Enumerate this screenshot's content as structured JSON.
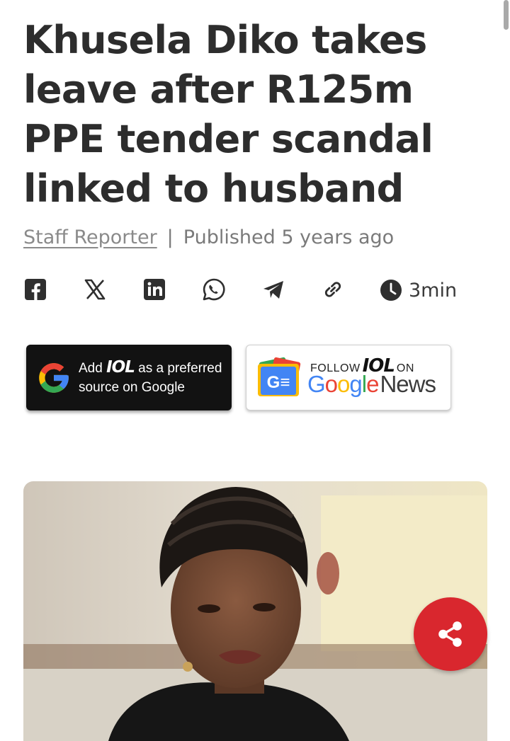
{
  "article": {
    "headline": "Khusela Diko takes leave after R125m PPE tender scandal linked to husband",
    "author": "Staff Reporter",
    "separator": "|",
    "published": "Published 5 years ago",
    "read_time": "3min"
  },
  "share_icons": [
    "facebook-icon",
    "x-icon",
    "linkedin-icon",
    "whatsapp-icon",
    "telegram-icon",
    "copy-link-icon"
  ],
  "google_preferred": {
    "line1_prefix": "Add",
    "brand": "IOL",
    "line1_suffix": "as a preferred",
    "line2": "source on Google"
  },
  "google_news": {
    "follow": "FOLLOW",
    "brand": "IOL",
    "on": "ON",
    "google_letters": [
      "G",
      "o",
      "o",
      "g",
      "l",
      "e"
    ],
    "news": "News",
    "badge": "G≡"
  },
  "colors": {
    "fab": "#d9272e",
    "google_blue": "#4285f4",
    "google_red": "#ea4335",
    "google_yellow": "#fbbc05",
    "google_green": "#34a853"
  }
}
